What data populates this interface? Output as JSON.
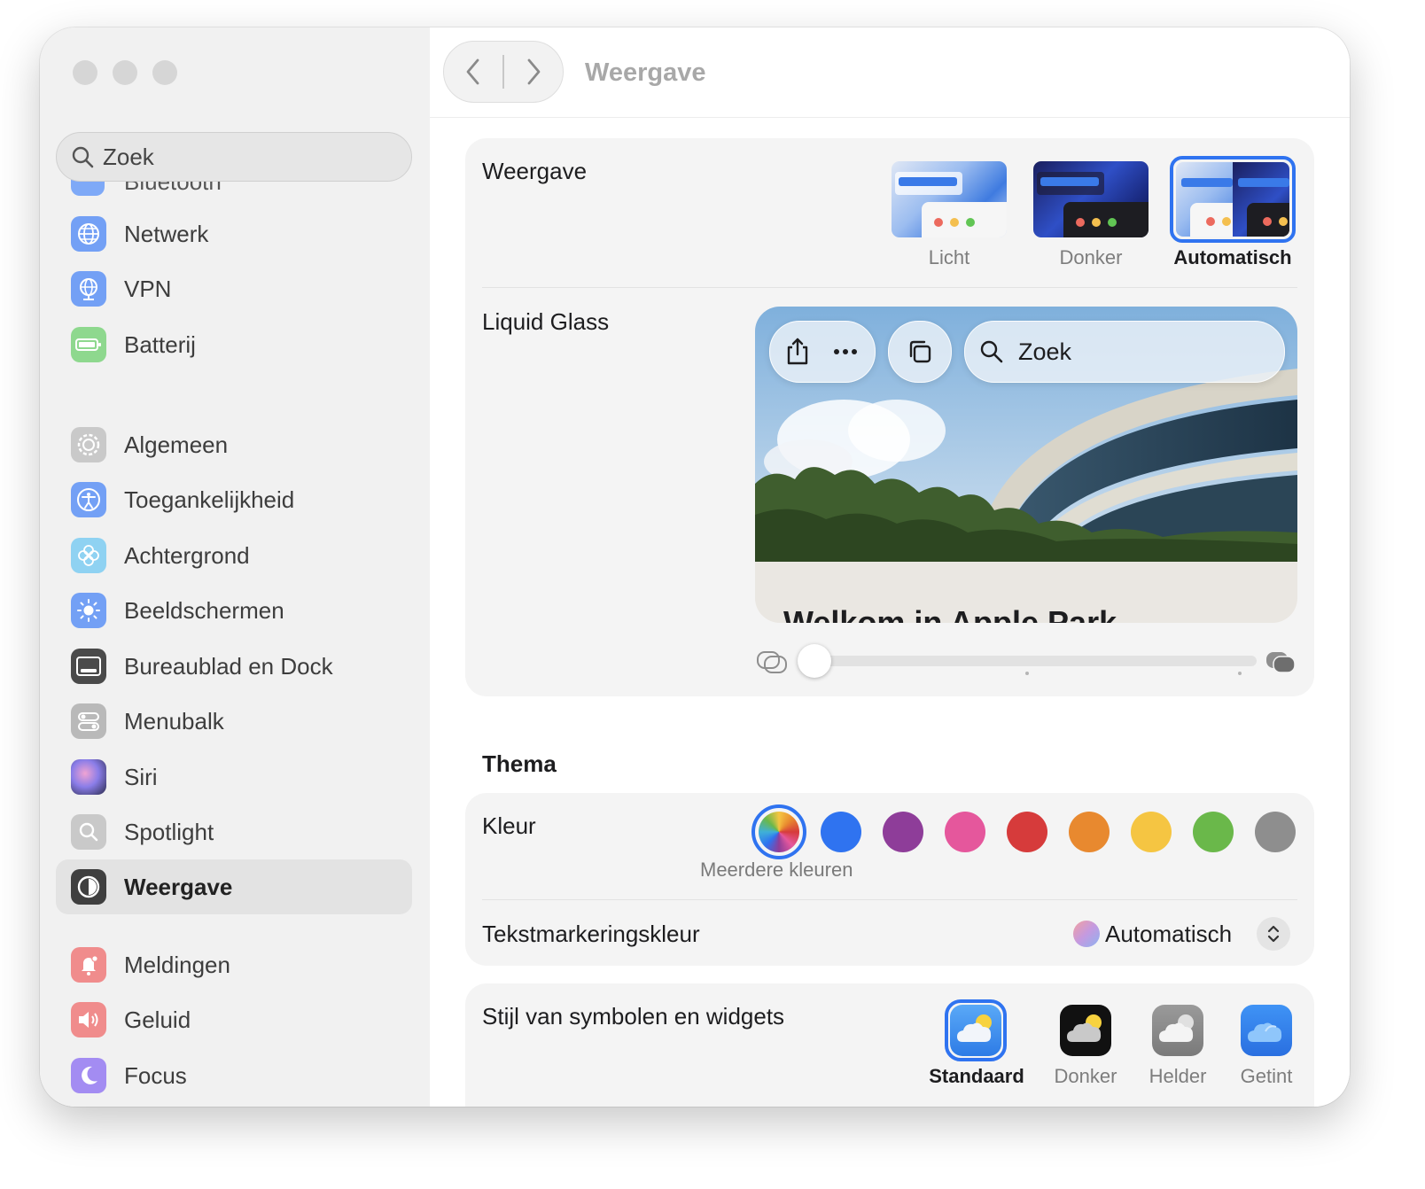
{
  "sidebar": {
    "search": {
      "placeholder": "Zoek"
    },
    "partially_hidden_item": "Bluetooth",
    "items": [
      {
        "label": "Netwerk",
        "icon": "network-globe-icon"
      },
      {
        "label": "VPN",
        "icon": "vpn-globe-icon"
      },
      {
        "label": "Batterij",
        "icon": "battery-icon"
      },
      {
        "label": "Algemeen",
        "icon": "gear-icon"
      },
      {
        "label": "Toegankelijkheid",
        "icon": "accessibility-icon"
      },
      {
        "label": "Achtergrond",
        "icon": "wallpaper-flower-icon"
      },
      {
        "label": "Beeldschermen",
        "icon": "display-sun-icon"
      },
      {
        "label": "Bureaublad en Dock",
        "icon": "desktop-dock-icon"
      },
      {
        "label": "Menubalk",
        "icon": "menubar-toggles-icon"
      },
      {
        "label": "Siri",
        "icon": "siri-icon"
      },
      {
        "label": "Spotlight",
        "icon": "spotlight-search-icon"
      },
      {
        "label": "Weergave",
        "icon": "appearance-icon",
        "selected": true
      },
      {
        "label": "Meldingen",
        "icon": "notifications-bell-icon"
      },
      {
        "label": "Geluid",
        "icon": "sound-speaker-icon"
      },
      {
        "label": "Focus",
        "icon": "focus-moon-icon"
      }
    ]
  },
  "toolbar": {
    "title": "Weergave"
  },
  "appearance": {
    "label": "Weergave",
    "options": [
      {
        "label": "Licht",
        "selected": false
      },
      {
        "label": "Donker",
        "selected": false
      },
      {
        "label": "Automatisch",
        "selected": true
      }
    ]
  },
  "liquid_glass": {
    "label": "Liquid Glass",
    "preview_search": "Zoek",
    "preview_heading": "Welkom in Apple Park",
    "slider_value": 0
  },
  "theme": {
    "heading": "Thema",
    "color_label": "Kleur",
    "colors": [
      "multicolor",
      "#2f73f0",
      "#8e3d99",
      "#e5579c",
      "#d63b3b",
      "#e8892f",
      "#f5c542",
      "#6ab84a",
      "#8e8e8e"
    ],
    "selected_color_caption": "Meerdere kleuren",
    "highlight_label": "Tekstmarkeringskleur",
    "highlight_value": "Automatisch"
  },
  "widgets": {
    "label": "Stijl van symbolen en widgets",
    "options": [
      {
        "label": "Standaard",
        "selected": true
      },
      {
        "label": "Donker",
        "selected": false
      },
      {
        "label": "Helder",
        "selected": false
      },
      {
        "label": "Getint",
        "selected": false
      }
    ]
  }
}
